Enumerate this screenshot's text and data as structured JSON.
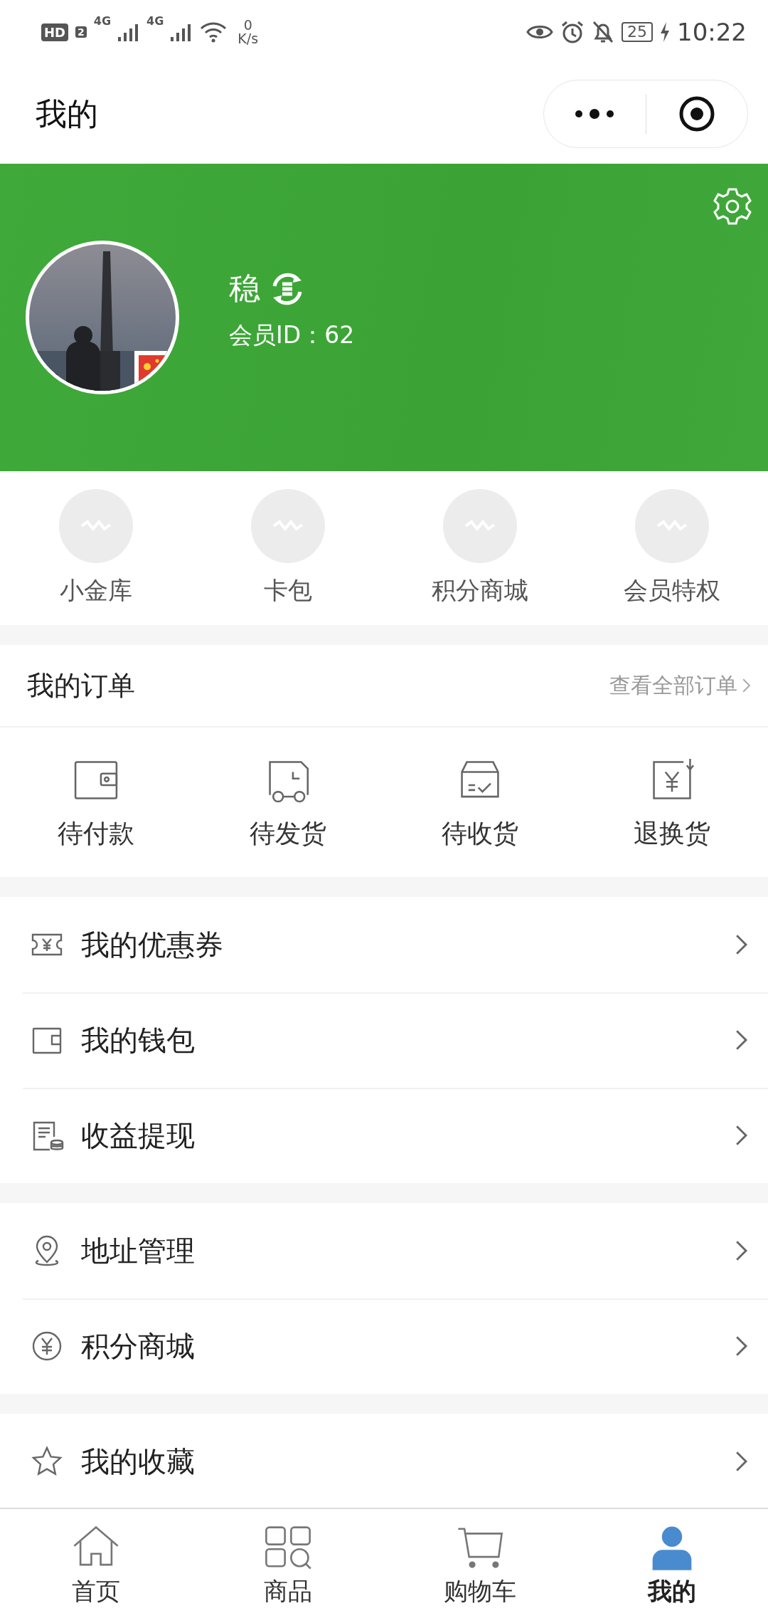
{
  "status_bar": {
    "hd": "HD",
    "sim": "2",
    "signals": [
      "4G",
      "4G"
    ],
    "speed_value": "0",
    "speed_unit": "K/s",
    "battery": "25",
    "time": "10:22"
  },
  "header": {
    "title": "我的"
  },
  "profile": {
    "name": "稳",
    "member_id": "会员ID：62"
  },
  "shortcuts": [
    {
      "label": "小金库"
    },
    {
      "label": "卡包"
    },
    {
      "label": "积分商城"
    },
    {
      "label": "会员特权"
    }
  ],
  "orders": {
    "title": "我的订单",
    "view_all": "查看全部订单",
    "items": [
      {
        "kind": "wallet",
        "label": "待付款"
      },
      {
        "kind": "truck",
        "label": "待发货"
      },
      {
        "kind": "box",
        "label": "待收货"
      },
      {
        "kind": "refund",
        "label": "退换货"
      }
    ]
  },
  "menu_groups": [
    {
      "items": [
        {
          "kind": "coupon",
          "label": "我的优惠券"
        },
        {
          "kind": "wallet",
          "label": "我的钱包"
        },
        {
          "kind": "bill",
          "label": "收益提现"
        }
      ]
    },
    {
      "items": [
        {
          "kind": "location",
          "label": "地址管理"
        },
        {
          "kind": "yuan",
          "label": "积分商城"
        }
      ]
    },
    {
      "items": [
        {
          "kind": "star",
          "label": "我的收藏"
        }
      ]
    }
  ],
  "tab_bar": [
    {
      "kind": "home",
      "label": "首页",
      "selected": false
    },
    {
      "kind": "grid",
      "label": "商品",
      "selected": false
    },
    {
      "kind": "cart",
      "label": "购物车",
      "selected": false
    },
    {
      "kind": "person",
      "label": "我的",
      "selected": true
    }
  ]
}
